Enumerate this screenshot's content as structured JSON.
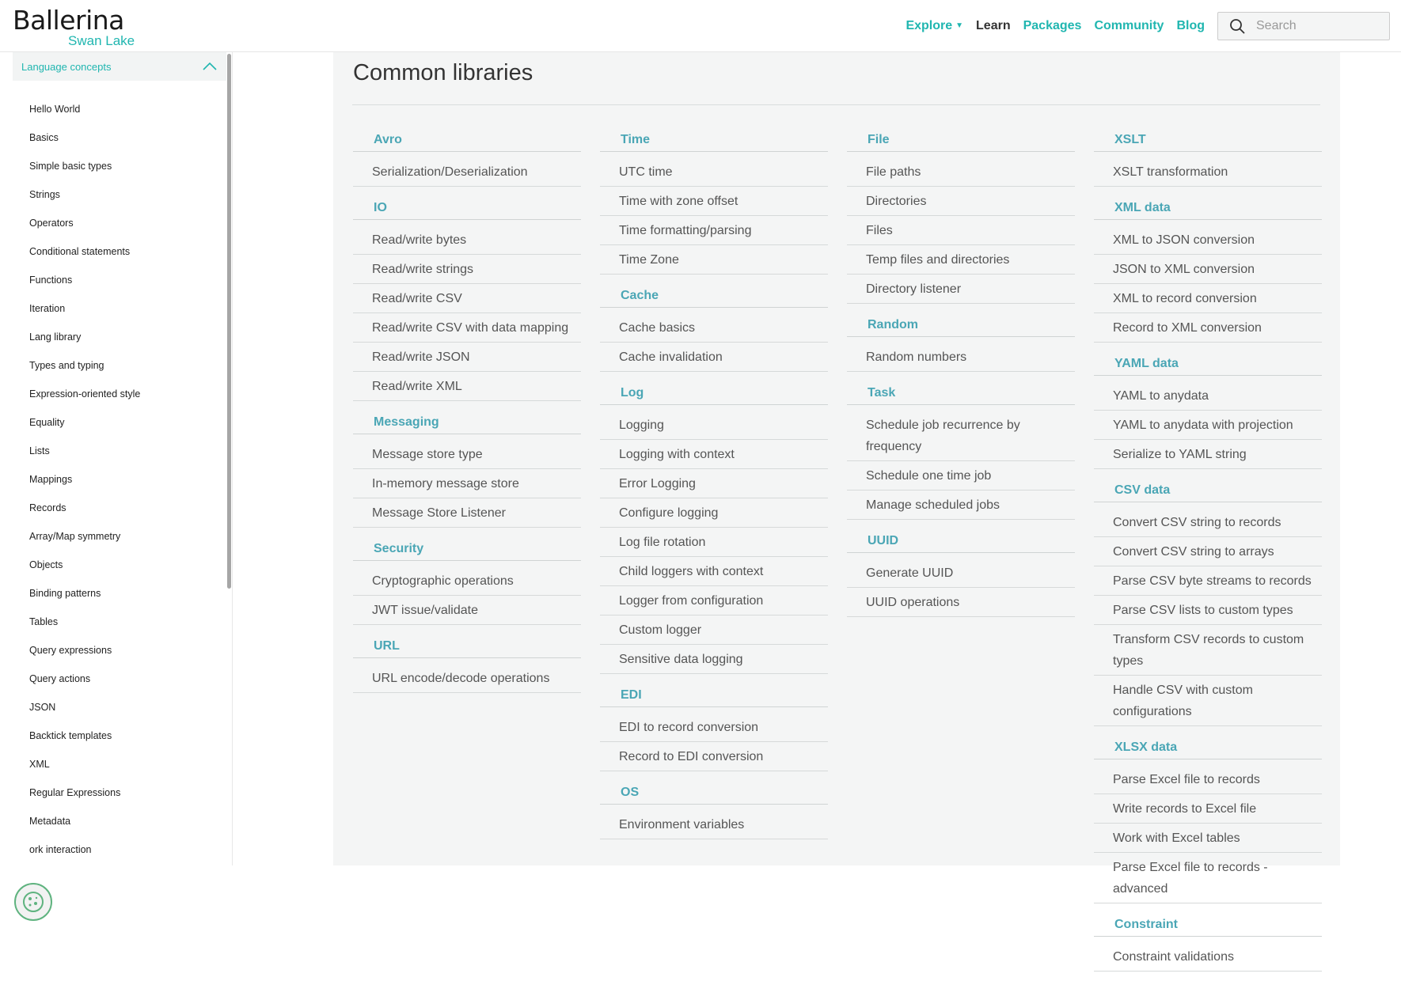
{
  "header": {
    "logo_main": "Ballerina",
    "logo_sub": "Swan Lake",
    "nav": [
      {
        "label": "Explore",
        "dropdown": true
      },
      {
        "label": "Learn",
        "active": true
      },
      {
        "label": "Packages"
      },
      {
        "label": "Community"
      },
      {
        "label": "Blog"
      }
    ],
    "search_placeholder": "Search"
  },
  "sidebar": {
    "section_label": "Language concepts",
    "items": [
      "Hello World",
      "Basics",
      "Simple basic types",
      "Strings",
      "Operators",
      "Conditional statements",
      "Functions",
      "Iteration",
      "Lang library",
      "Types and typing",
      "Expression-oriented style",
      "Equality",
      "Lists",
      "Mappings",
      "Records",
      "Array/Map symmetry",
      "Objects",
      "Binding patterns",
      "Tables",
      "Query expressions",
      "Query actions",
      "JSON",
      "Backtick templates",
      "XML",
      "Regular Expressions",
      "Metadata",
      "ork interaction"
    ]
  },
  "content": {
    "title": "Common libraries",
    "columns": [
      [
        {
          "title": "Avro",
          "links": [
            "Serialization/Deserialization"
          ]
        },
        {
          "title": "IO",
          "links": [
            "Read/write bytes",
            "Read/write strings",
            "Read/write CSV",
            "Read/write CSV with data mapping",
            "Read/write JSON",
            "Read/write XML"
          ]
        },
        {
          "title": "Messaging",
          "links": [
            "Message store type",
            "In-memory message store",
            "Message Store Listener"
          ]
        },
        {
          "title": "Security",
          "links": [
            "Cryptographic operations",
            "JWT issue/validate"
          ]
        },
        {
          "title": "URL",
          "links": [
            "URL encode/decode operations"
          ]
        }
      ],
      [
        {
          "title": "Time",
          "links": [
            "UTC time",
            "Time with zone offset",
            "Time formatting/parsing",
            "Time Zone"
          ]
        },
        {
          "title": "Cache",
          "links": [
            "Cache basics",
            "Cache invalidation"
          ]
        },
        {
          "title": "Log",
          "links": [
            "Logging",
            "Logging with context",
            "Error Logging",
            "Configure logging",
            "Log file rotation",
            "Child loggers with context",
            "Logger from configuration",
            "Custom logger",
            "Sensitive data logging"
          ]
        },
        {
          "title": "EDI",
          "links": [
            "EDI to record conversion",
            "Record to EDI conversion"
          ]
        },
        {
          "title": "OS",
          "links": [
            "Environment variables"
          ]
        }
      ],
      [
        {
          "title": "File",
          "links": [
            "File paths",
            "Directories",
            "Files",
            "Temp files and directories",
            "Directory listener"
          ]
        },
        {
          "title": "Random",
          "links": [
            "Random numbers"
          ]
        },
        {
          "title": "Task",
          "links": [
            "Schedule job recurrence by frequency",
            "Schedule one time job",
            "Manage scheduled jobs"
          ]
        },
        {
          "title": "UUID",
          "links": [
            "Generate UUID",
            "UUID operations"
          ]
        }
      ],
      [
        {
          "title": "XSLT",
          "links": [
            "XSLT transformation"
          ]
        },
        {
          "title": "XML data",
          "links": [
            "XML to JSON conversion",
            "JSON to XML conversion",
            "XML to record conversion",
            "Record to XML conversion"
          ]
        },
        {
          "title": "YAML data",
          "links": [
            "YAML to anydata",
            "YAML to anydata with projection",
            "Serialize to YAML string"
          ]
        },
        {
          "title": "CSV data",
          "links": [
            "Convert CSV string to records",
            "Convert CSV string to arrays",
            "Parse CSV byte streams to records",
            "Parse CSV lists to custom types",
            "Transform CSV records to custom types",
            "Handle CSV with custom configurations"
          ]
        },
        {
          "title": "XLSX data",
          "links": [
            "Parse Excel file to records",
            "Write records to Excel file",
            "Work with Excel tables",
            "Parse Excel file to records - advanced"
          ]
        },
        {
          "title": "Constraint",
          "links": [
            "Constraint validations"
          ]
        }
      ]
    ]
  },
  "colors": {
    "accent": "#20b6b0",
    "section_title": "#4aa6b5",
    "content_bg": "#f4f5f5"
  }
}
